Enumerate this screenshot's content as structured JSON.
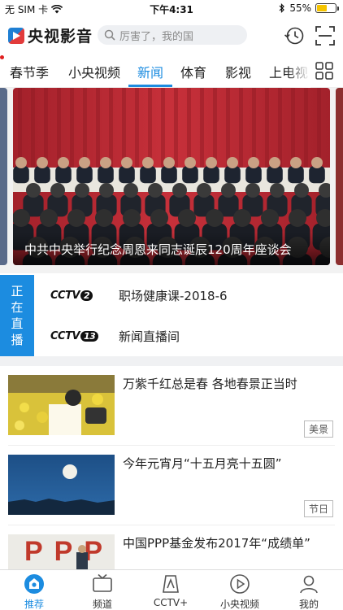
{
  "status_bar": {
    "carrier": "无 SIM 卡",
    "time": "下午4:31",
    "battery": "55%",
    "battery_level": 0.55
  },
  "header": {
    "app_name": "央视影音",
    "search_placeholder": "厉害了，我的国",
    "icons": [
      "logo-icon",
      "search-icon",
      "history-icon",
      "scan-icon"
    ]
  },
  "tabs": {
    "items": [
      "春节季",
      "小央视频",
      "新闻",
      "体育",
      "影视",
      "上电视"
    ],
    "active": "新闻",
    "menu_icon": "grid-menu-icon"
  },
  "hero": {
    "caption": "中共中央举行纪念周恩来同志诞辰120周年座谈会"
  },
  "live": {
    "badge": [
      "正",
      "在",
      "直",
      "播"
    ],
    "channels": [
      {
        "logo_text": "CCTV",
        "number": "2",
        "title": "职场健康课-2018-6"
      },
      {
        "logo_text": "CCTV",
        "number": "13",
        "title": "新闻直播间"
      }
    ]
  },
  "news": [
    {
      "title": "万紫千红总是春 各地春景正当时",
      "tag": "美景"
    },
    {
      "title": "今年元宵月“十五月亮十五圆”",
      "tag": "节日"
    },
    {
      "title": "中国PPP基金发布2017年“成绩单”",
      "thumb_text": "PPP"
    }
  ],
  "bottom_nav": {
    "items": [
      {
        "label": "推荐",
        "icon": "recommend-icon"
      },
      {
        "label": "频道",
        "icon": "tv-icon"
      },
      {
        "label": "CCTV+",
        "icon": "cctv-plus-icon"
      },
      {
        "label": "小央视频",
        "icon": "play-icon"
      },
      {
        "label": "我的",
        "icon": "profile-icon"
      }
    ],
    "active": "推荐"
  },
  "colors": {
    "accent": "#1c8ce0",
    "search_bg": "#eef0f3",
    "live_badge": "#1c8ce0"
  }
}
